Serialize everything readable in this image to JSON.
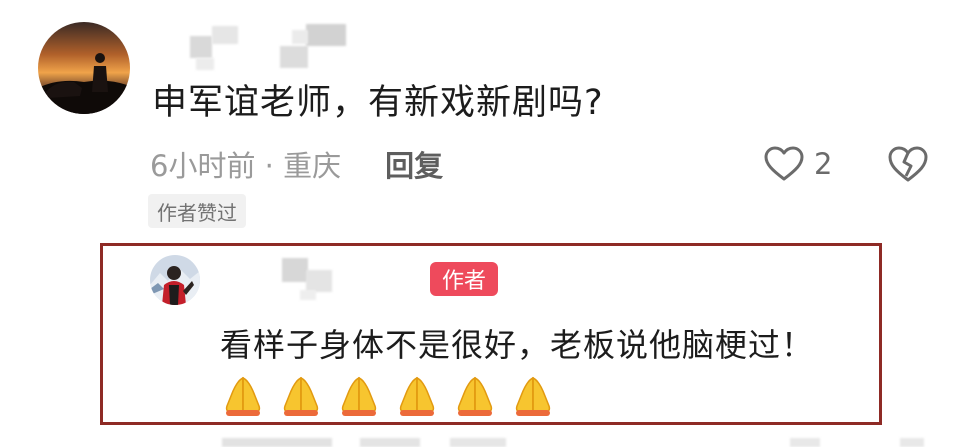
{
  "comment": {
    "text": "申军谊老师，有新戏新剧吗?",
    "time_location": "6小时前 · 重庆",
    "reply_label": "回复",
    "like_count": "2",
    "author_liked_tag": "作者赞过"
  },
  "reply": {
    "author_badge": "作者",
    "text": "看样子身体不是很好，老板说他脑梗过！",
    "emoji_count": 6,
    "emoji": "folded-hands"
  },
  "colors": {
    "highlight_border": "#8e2a25",
    "author_badge_bg": "#ee4a5c",
    "meta_text": "#9a9a9a"
  },
  "icons": [
    "heart-outline-icon",
    "broken-heart-icon",
    "folded-hands-emoji"
  ]
}
